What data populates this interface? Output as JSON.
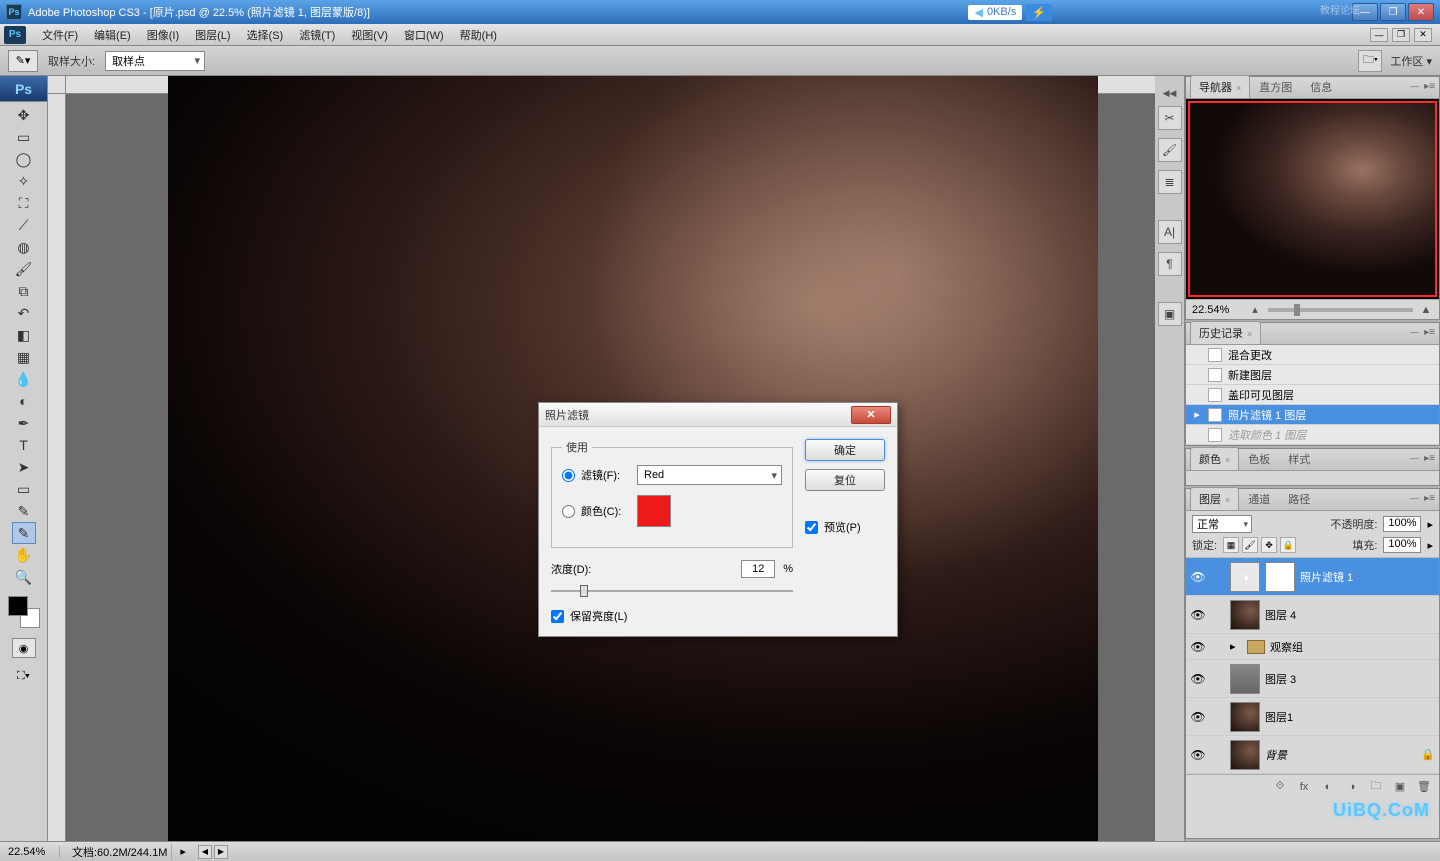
{
  "titlebar": {
    "app_title": "Adobe Photoshop CS3 - [原片.psd @ 22.5% (照片滤镜 1, 图层蒙版/8)]",
    "net_speed": "0KB/s",
    "watermark": "教程论坛"
  },
  "menubar": {
    "items": [
      "文件(F)",
      "编辑(E)",
      "图像(I)",
      "图层(L)",
      "选择(S)",
      "滤镜(T)",
      "视图(V)",
      "窗口(W)",
      "帮助(H)"
    ]
  },
  "optionsbar": {
    "sample_size_label": "取样大小:",
    "sample_size_value": "取样点",
    "workspace_label": "工作区 ▾"
  },
  "dialog": {
    "title": "照片滤镜",
    "use_legend": "使用",
    "filter_radio_label": "滤镜(F):",
    "filter_value": "Red",
    "color_radio_label": "颜色(C):",
    "color_hex": "#ec1a1a",
    "density_label": "浓度(D):",
    "density_value": "12",
    "density_unit": "%",
    "preserve_lum_label": "保留亮度(L)",
    "ok_label": "确定",
    "reset_label": "复位",
    "preview_label": "预览(P)"
  },
  "navigator": {
    "tabs": [
      "导航器",
      "直方图",
      "信息"
    ],
    "zoom": "22.54%"
  },
  "history": {
    "tab": "历史记录",
    "items": [
      {
        "label": "混合更改",
        "selected": false,
        "dimmed": false
      },
      {
        "label": "新建图层",
        "selected": false,
        "dimmed": false
      },
      {
        "label": "盖印可见图层",
        "selected": false,
        "dimmed": false
      },
      {
        "label": "照片滤镜 1 图层",
        "selected": true,
        "dimmed": false
      },
      {
        "label": "选取颜色 1 图层",
        "selected": false,
        "dimmed": true
      }
    ]
  },
  "color_panel": {
    "tabs": [
      "颜色",
      "色板",
      "样式"
    ]
  },
  "layers_panel": {
    "tabs": [
      "图层",
      "通道",
      "路径"
    ],
    "blend_mode": "正常",
    "opacity_label": "不透明度:",
    "opacity_value": "100%",
    "lock_label": "锁定:",
    "fill_label": "填充:",
    "fill_value": "100%",
    "layers": [
      {
        "name": "照片滤镜 1",
        "type": "adjustment",
        "selected": true,
        "visible": true
      },
      {
        "name": "图层 4",
        "type": "pixel",
        "selected": false,
        "visible": true
      },
      {
        "name": "观察组",
        "type": "group",
        "selected": false,
        "visible": true
      },
      {
        "name": "图层 3",
        "type": "gray",
        "selected": false,
        "visible": true
      },
      {
        "name": "图层1",
        "type": "pixel",
        "selected": false,
        "visible": true
      },
      {
        "name": "背景",
        "type": "bg",
        "selected": false,
        "visible": true,
        "locked": true
      }
    ]
  },
  "statusbar": {
    "zoom": "22.54%",
    "doc_info": "文档:60.2M/244.1M"
  },
  "watermark_corner": "UiBQ.CoM"
}
